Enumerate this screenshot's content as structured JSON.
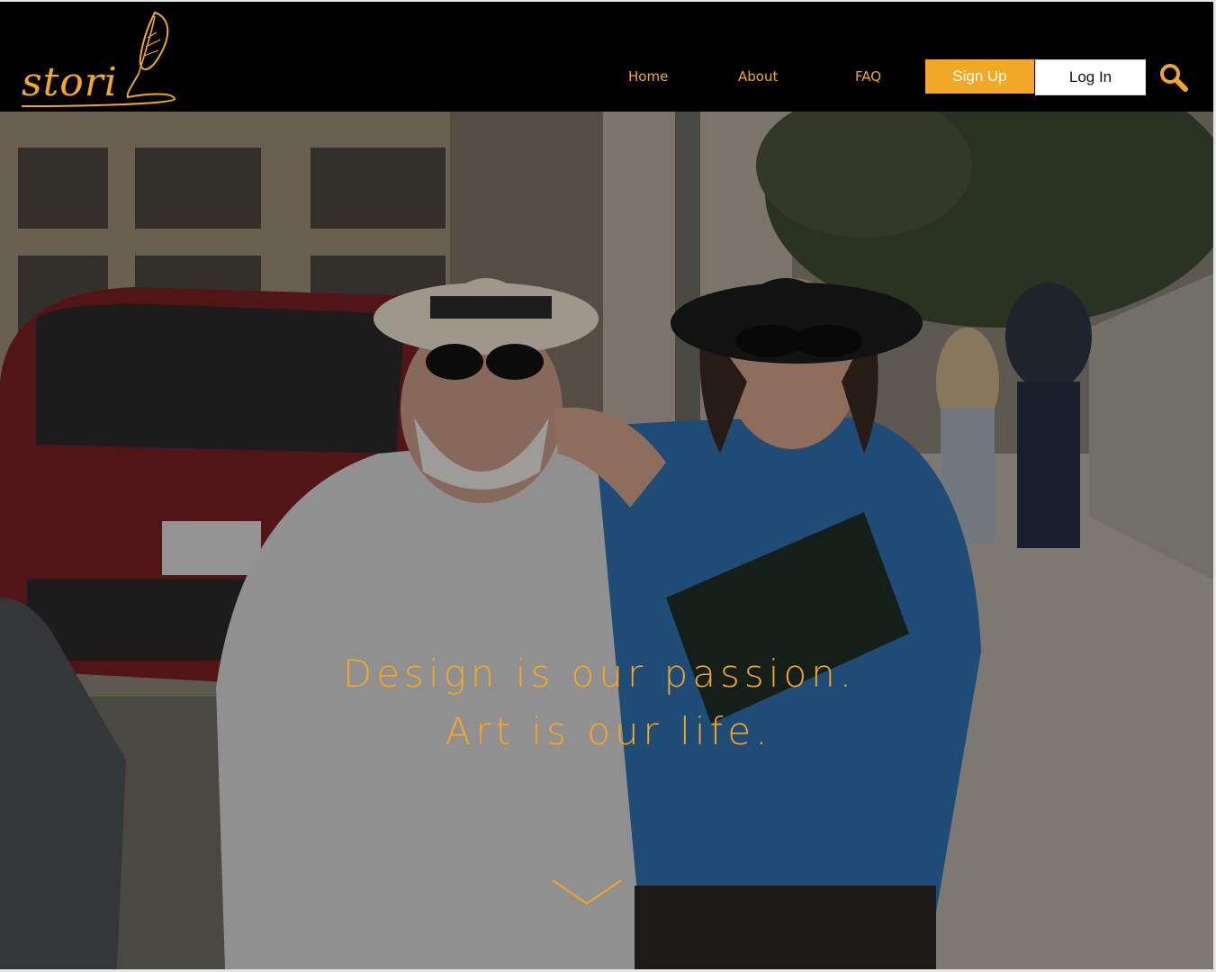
{
  "brand": {
    "name": "stori"
  },
  "nav": {
    "items": [
      {
        "label": "Home"
      },
      {
        "label": "About"
      },
      {
        "label": "FAQ"
      }
    ],
    "signup_label": "Sign Up",
    "login_label": "Log In",
    "search_icon": "search-icon"
  },
  "hero": {
    "line1": "Design is our passion.",
    "line2": "Art is our life.",
    "scroll_icon": "chevron-down-icon"
  },
  "colors": {
    "accent": "#f2a726",
    "header_bg": "#000000"
  }
}
